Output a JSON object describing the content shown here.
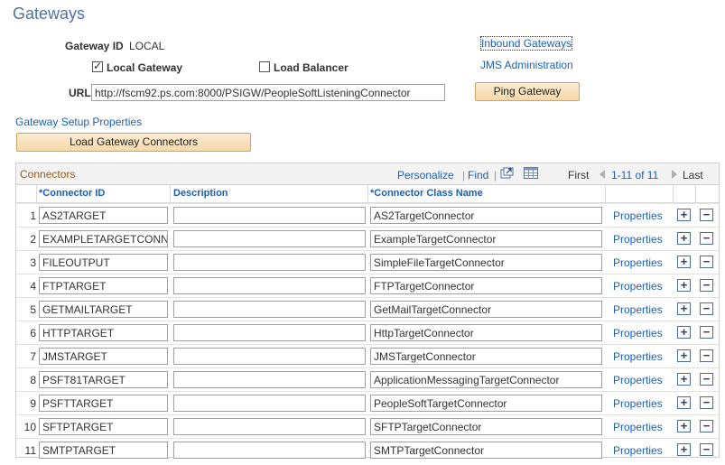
{
  "page": {
    "title": "Gateways"
  },
  "gateway": {
    "id_label": "Gateway ID",
    "id_value": "LOCAL",
    "local_gateway_label": "Local Gateway",
    "local_gateway_checked": true,
    "load_balancer_label": "Load Balancer",
    "load_balancer_checked": false,
    "url_label": "URL",
    "url_value": "http://fscm92.ps.com:8000/PSIGW/PeopleSoftListeningConnector"
  },
  "links": {
    "inbound_gateways": "Inbound Gateways",
    "jms_administration": "JMS Administration",
    "gateway_setup_properties": "Gateway Setup Properties"
  },
  "buttons": {
    "ping_gateway": "Ping Gateway",
    "load_gateway_connectors": "Load Gateway Connectors"
  },
  "grid": {
    "title": "Connectors",
    "personalize": "Personalize",
    "find": "Find",
    "first": "First",
    "range": "1-11 of 11",
    "last": "Last",
    "columns": {
      "connector_id": "*Connector ID",
      "description": "Description",
      "connector_class": "*Connector Class Name"
    },
    "properties_label": "Properties",
    "add_symbol": "+",
    "remove_symbol": "−",
    "rows": [
      {
        "num": "1",
        "id": "AS2TARGET",
        "description": "",
        "class": "AS2TargetConnector"
      },
      {
        "num": "2",
        "id": "EXAMPLETARGETCONNE",
        "description": "",
        "class": "ExampleTargetConnector"
      },
      {
        "num": "3",
        "id": "FILEOUTPUT",
        "description": "",
        "class": "SimpleFileTargetConnector"
      },
      {
        "num": "4",
        "id": "FTPTARGET",
        "description": "",
        "class": "FTPTargetConnector"
      },
      {
        "num": "5",
        "id": "GETMAILTARGET",
        "description": "",
        "class": "GetMailTargetConnector"
      },
      {
        "num": "6",
        "id": "HTTPTARGET",
        "description": "",
        "class": "HttpTargetConnector"
      },
      {
        "num": "7",
        "id": "JMSTARGET",
        "description": "",
        "class": "JMSTargetConnector"
      },
      {
        "num": "8",
        "id": "PSFT81TARGET",
        "description": "",
        "class": "ApplicationMessagingTargetConnector"
      },
      {
        "num": "9",
        "id": "PSFTTARGET",
        "description": "",
        "class": "PeopleSoftTargetConnector"
      },
      {
        "num": "10",
        "id": "SFTPTARGET",
        "description": "",
        "class": "SFTPTargetConnector"
      },
      {
        "num": "11",
        "id": "SMTPTARGET",
        "description": "",
        "class": "SMTPTargetConnector"
      }
    ]
  },
  "colors": {
    "title_blue": "#4e73a6",
    "link_blue": "#1a5fb4",
    "grid_title_brown": "#9a5a1b",
    "button_fill": "#f7d9a8"
  }
}
